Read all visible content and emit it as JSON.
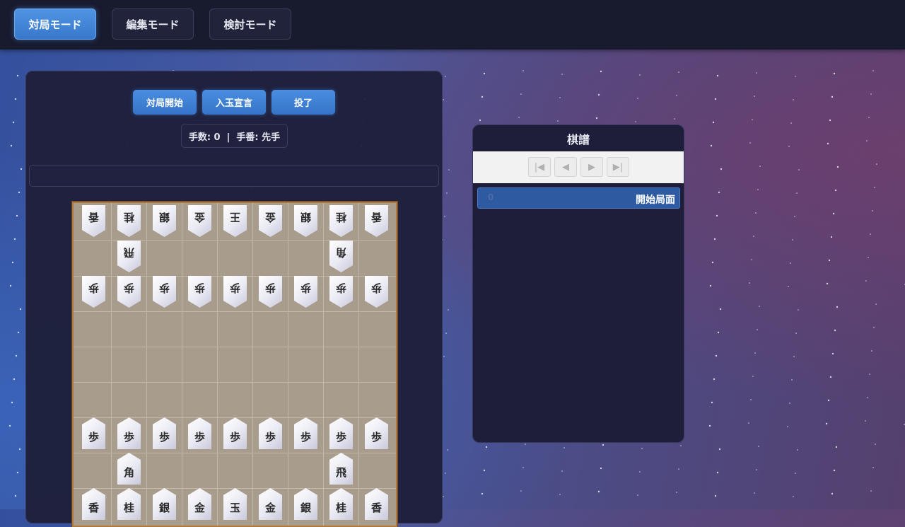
{
  "modes": [
    {
      "label": "対局モード",
      "active": true
    },
    {
      "label": "編集モード",
      "active": false
    },
    {
      "label": "検討モード",
      "active": false
    }
  ],
  "game": {
    "actions": [
      "対局開始",
      "入玉宣言",
      "投了"
    ],
    "move_info": "手数: 0  |  手番: 先手",
    "message": ""
  },
  "board": {
    "gote_rows": [
      [
        "香",
        "桂",
        "銀",
        "金",
        "王",
        "金",
        "銀",
        "桂",
        "香"
      ],
      [
        "",
        "飛",
        "",
        "",
        "",
        "",
        "",
        "角",
        ""
      ],
      [
        "歩",
        "歩",
        "歩",
        "歩",
        "歩",
        "歩",
        "歩",
        "歩",
        "歩"
      ]
    ],
    "sente_rows": [
      [
        "歩",
        "歩",
        "歩",
        "歩",
        "歩",
        "歩",
        "歩",
        "歩",
        "歩"
      ],
      [
        "",
        "角",
        "",
        "",
        "",
        "",
        "",
        "飛",
        ""
      ],
      [
        "香",
        "桂",
        "銀",
        "金",
        "玉",
        "金",
        "銀",
        "桂",
        "香"
      ]
    ]
  },
  "kifu": {
    "title": "棋譜",
    "nav": {
      "first": "|◀",
      "prev": "◀",
      "next": "▶",
      "last": "▶|"
    },
    "entries": [
      {
        "no": "0",
        "text": "開始局面"
      }
    ]
  },
  "colors": {
    "accent": "#3a7bd0",
    "panel": "#1e1f3a",
    "board": "#a89c8c"
  }
}
